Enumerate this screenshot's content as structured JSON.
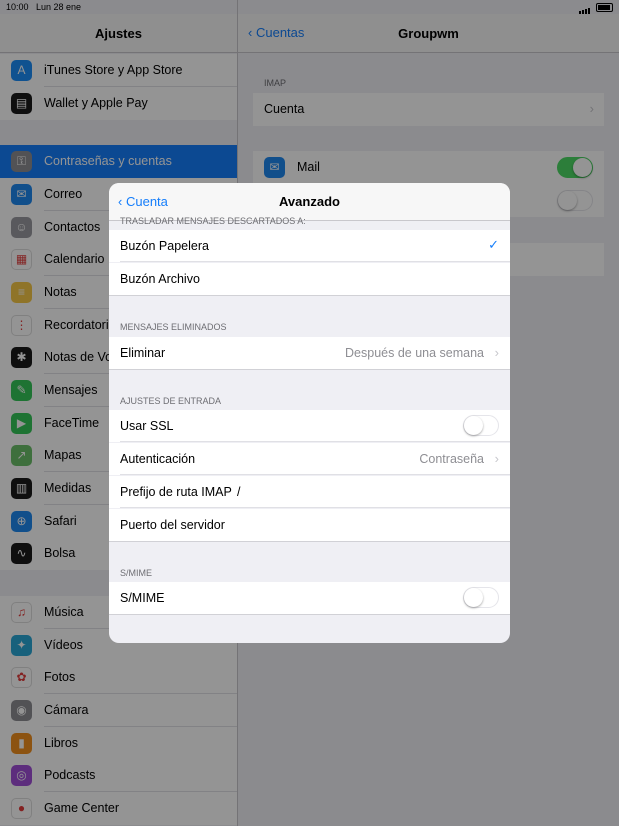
{
  "status": {
    "time": "10:00",
    "date": "Lun 28 ene"
  },
  "master": {
    "title": "Ajustes",
    "items": [
      {
        "label": "iTunes Store y App Store",
        "color": "#1c8ef9",
        "glyph": "A"
      },
      {
        "label": "Wallet y Apple Pay",
        "color": "#1b1b1b",
        "glyph": "▤"
      },
      {
        "label": "Contraseñas y cuentas",
        "color": "#8e8e93",
        "glyph": "⚿"
      },
      {
        "label": "Correo",
        "color": "#1e88f0",
        "glyph": "✉"
      },
      {
        "label": "Contactos",
        "color": "#9a9aa0",
        "glyph": "☺"
      },
      {
        "label": "Calendario",
        "color": "#ffffff",
        "glyph": "▦"
      },
      {
        "label": "Notas",
        "color": "#f7c948",
        "glyph": "≡"
      },
      {
        "label": "Recordatorios",
        "color": "#ffffff",
        "glyph": "⋮"
      },
      {
        "label": "Notas de Voz",
        "color": "#1b1b1b",
        "glyph": "✱"
      },
      {
        "label": "Mensajes",
        "color": "#35c759",
        "glyph": "✎"
      },
      {
        "label": "FaceTime",
        "color": "#35c759",
        "glyph": "▶"
      },
      {
        "label": "Mapas",
        "color": "#6cbf6a",
        "glyph": "↗"
      },
      {
        "label": "Medidas",
        "color": "#1b1b1b",
        "glyph": "▥"
      },
      {
        "label": "Safari",
        "color": "#1e88f0",
        "glyph": "⊕"
      },
      {
        "label": "Bolsa",
        "color": "#1b1b1b",
        "glyph": "∿"
      },
      {
        "label": "Música",
        "color": "#ffffff",
        "glyph": "♫"
      },
      {
        "label": "Vídeos",
        "color": "#2aa7d6",
        "glyph": "✦"
      },
      {
        "label": "Fotos",
        "color": "#ffffff",
        "glyph": "✿"
      },
      {
        "label": "Cámara",
        "color": "#8e8e93",
        "glyph": "◉"
      },
      {
        "label": "Libros",
        "color": "#f18f1e",
        "glyph": "▮"
      },
      {
        "label": "Podcasts",
        "color": "#a04fd8",
        "glyph": "◎"
      },
      {
        "label": "Game Center",
        "color": "#ffffff",
        "glyph": "●"
      }
    ]
  },
  "detail": {
    "back": "Cuentas",
    "title": "Groupwm",
    "imap_header": "IMAP",
    "cuenta": "Cuenta",
    "mail": "Mail"
  },
  "modal": {
    "back": "Cuenta",
    "title": "Avanzado",
    "trasladar_header": "TRASLADAR MENSAJES DESCARTADOS A:",
    "buzon_papelera": "Buzón Papelera",
    "buzon_archivo": "Buzón Archivo",
    "eliminados_header": "MENSAJES ELIMINADOS",
    "eliminar": "Eliminar",
    "eliminar_value": "Después de una semana",
    "entrada_header": "AJUSTES DE ENTRADA",
    "usar_ssl": "Usar SSL",
    "autenticacion": "Autenticación",
    "autenticacion_value": "Contraseña",
    "prefijo": "Prefijo de ruta IMAP",
    "prefijo_value": "/",
    "puerto": "Puerto del servidor",
    "smime_header": "S/MIME",
    "smime": "S/MIME"
  },
  "colors": {
    "accent": "#157efb",
    "switch_on": "#4cd964"
  }
}
